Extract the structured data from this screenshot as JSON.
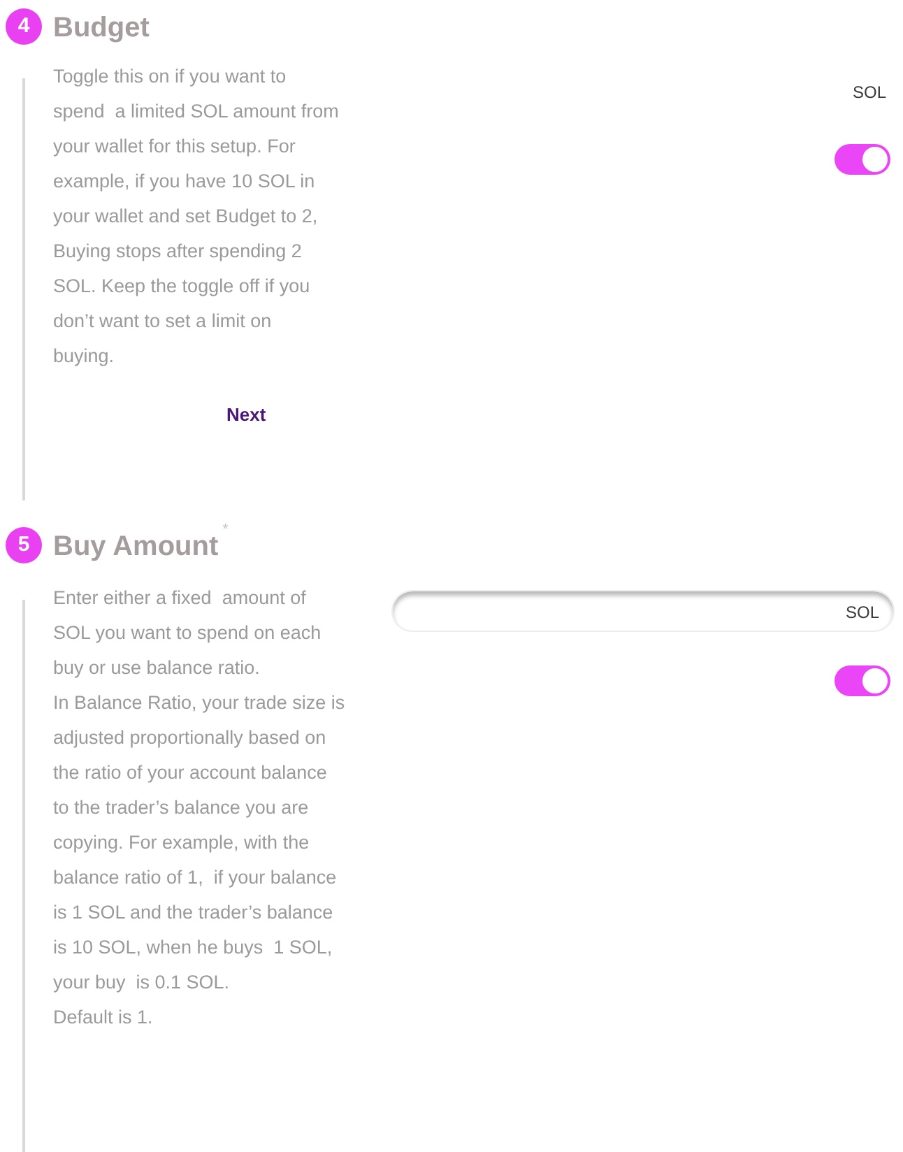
{
  "steps": [
    {
      "number": "4",
      "title": "Budget",
      "description": [
        "Toggle this on if you want to\nspend  a limited SOL amount from\nyour wallet for this setup. For\nexample, if you have 10 SOL in\nyour wallet and set Budget to 2,\nBuying stops after spending 2\nSOL. Keep the toggle off if you\ndon’t want to set a limit on\nbuying."
      ],
      "controls": [
        {
          "kind": "unit",
          "text": "SOL"
        },
        {
          "kind": "toggle",
          "on": true
        }
      ],
      "next_button": "Next"
    },
    {
      "number": "5",
      "title": "Buy Amount",
      "required_mark": "*",
      "description": [
        "Enter either a fixed  amount of\nSOL you want to spend on each\nbuy or use balance ratio.",
        "In Balance Ratio, your trade size is\nadjusted proportionally based on\nthe ratio of your account balance\nto the trader’s balance you are\ncopying. For example, with the\nbalance ratio of 1,  if your balance\nis 1 SOL and the trader’s balance\nis 10 SOL, when he buys  1 SOL,\nyour buy  is 0.1 SOL.",
        "Default is 1."
      ],
      "controls": [
        {
          "kind": "amount_field",
          "suffix": "SOL"
        },
        {
          "kind": "toggle",
          "on": true
        }
      ]
    }
  ]
}
